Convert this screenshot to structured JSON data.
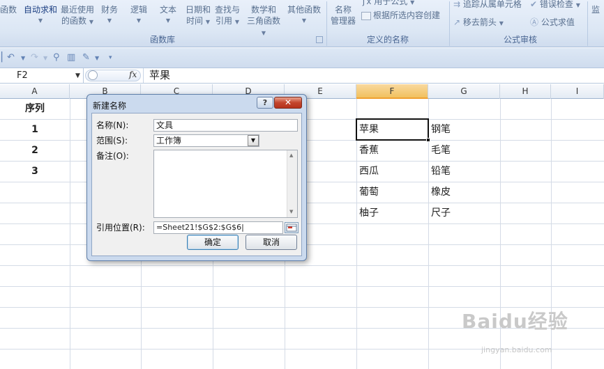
{
  "ribbon": {
    "buttons": [
      {
        "label": "函数",
        "id": "fn-partial"
      },
      {
        "label": "自动求和",
        "id": "autosum"
      },
      {
        "label": "最近使用\n的函数",
        "id": "recent"
      },
      {
        "label": "财务",
        "id": "finance"
      },
      {
        "label": "逻辑",
        "id": "logic"
      },
      {
        "label": "文本",
        "id": "text"
      },
      {
        "label": "日期和\n时间",
        "id": "datetime"
      },
      {
        "label": "查找与\n引用",
        "id": "lookup"
      },
      {
        "label": "数学和\n三角函数",
        "id": "math"
      },
      {
        "label": "其他函数",
        "id": "more"
      }
    ],
    "name_manager": "名称\n管理器",
    "use_in_formula": "用于公式",
    "create_from_selection": "根据所选内容创建",
    "trace_precedents": "追踪从属单元格",
    "remove_arrows": "移去箭头",
    "error_check": "错误检查",
    "evaluate_formula": "公式求值",
    "monitor": "监",
    "groups": {
      "function_library": "函数库",
      "defined_names": "定义的名称",
      "formula_auditing": "公式审核"
    }
  },
  "formula_bar": {
    "name_box": "F2",
    "fx": "fx",
    "value": "苹果"
  },
  "columns": [
    "A",
    "B",
    "C",
    "D",
    "E",
    "F",
    "G",
    "H",
    "I"
  ],
  "selected_column": "F",
  "cells": {
    "A1": "序列",
    "A2": "1",
    "A3": "2",
    "A4": "3",
    "F2": "苹果",
    "F3": "香蕉",
    "F4": "西瓜",
    "F5": "葡萄",
    "F6": "柚子",
    "G2": "钢笔",
    "G3": "毛笔",
    "G4": "铅笔",
    "G5": "橡皮",
    "G6": "尺子"
  },
  "dialog": {
    "title": "新建名称",
    "help": "?",
    "close": "✕",
    "name_label": "名称(N):",
    "name_value": "文具",
    "scope_label": "范围(S):",
    "scope_value": "工作簿",
    "comment_label": "备注(O):",
    "comment_value": "",
    "refers_label": "引用位置(R):",
    "refers_value": "=Sheet21!$G$2:$G$6|",
    "ok": "确定",
    "cancel": "取消"
  },
  "watermark": {
    "brand": "Baidu经验",
    "url": "jingyan.baidu.com"
  },
  "colors": {
    "ribbon_bg": "#dbe6f4",
    "selection_header": "#f1c15f",
    "close_button": "#c3452c"
  }
}
